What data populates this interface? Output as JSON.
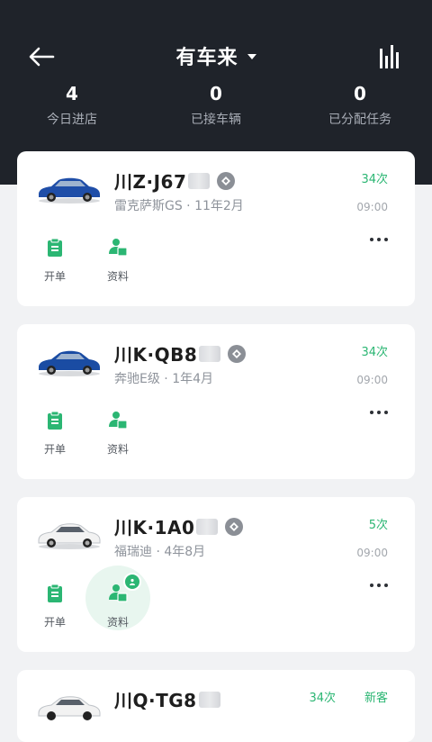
{
  "header": {
    "title": "有车来",
    "stats": [
      {
        "value": "4",
        "label": "今日进店"
      },
      {
        "value": "0",
        "label": "已接车辆"
      },
      {
        "value": "0",
        "label": "已分配任务"
      }
    ]
  },
  "cards": [
    {
      "plate": "川Z·J67",
      "subtitle": "雷克萨斯GS · 11年2月",
      "count": "34次",
      "time": "09:00",
      "actions": [
        "开单",
        "资料"
      ],
      "car_color": "#1f4ea8"
    },
    {
      "plate": "川K·QB8",
      "subtitle": "奔驰E级 · 1年4月",
      "count": "34次",
      "time": "09:00",
      "actions": [
        "开单",
        "资料"
      ],
      "car_color": "#1a4ca3"
    },
    {
      "plate": "川K·1A0",
      "subtitle": "福瑞迪 · 4年8月",
      "count": "5次",
      "time": "09:00",
      "actions": [
        "开单",
        "资料"
      ],
      "car_color": "#f2f2f2"
    },
    {
      "plate": "川Q·TG8",
      "subtitle": "",
      "count": "34次",
      "tag": "新客",
      "car_color": "#f2f2f2"
    }
  ],
  "colors": {
    "accent": "#2bb673",
    "header_bg": "#1f232a"
  }
}
